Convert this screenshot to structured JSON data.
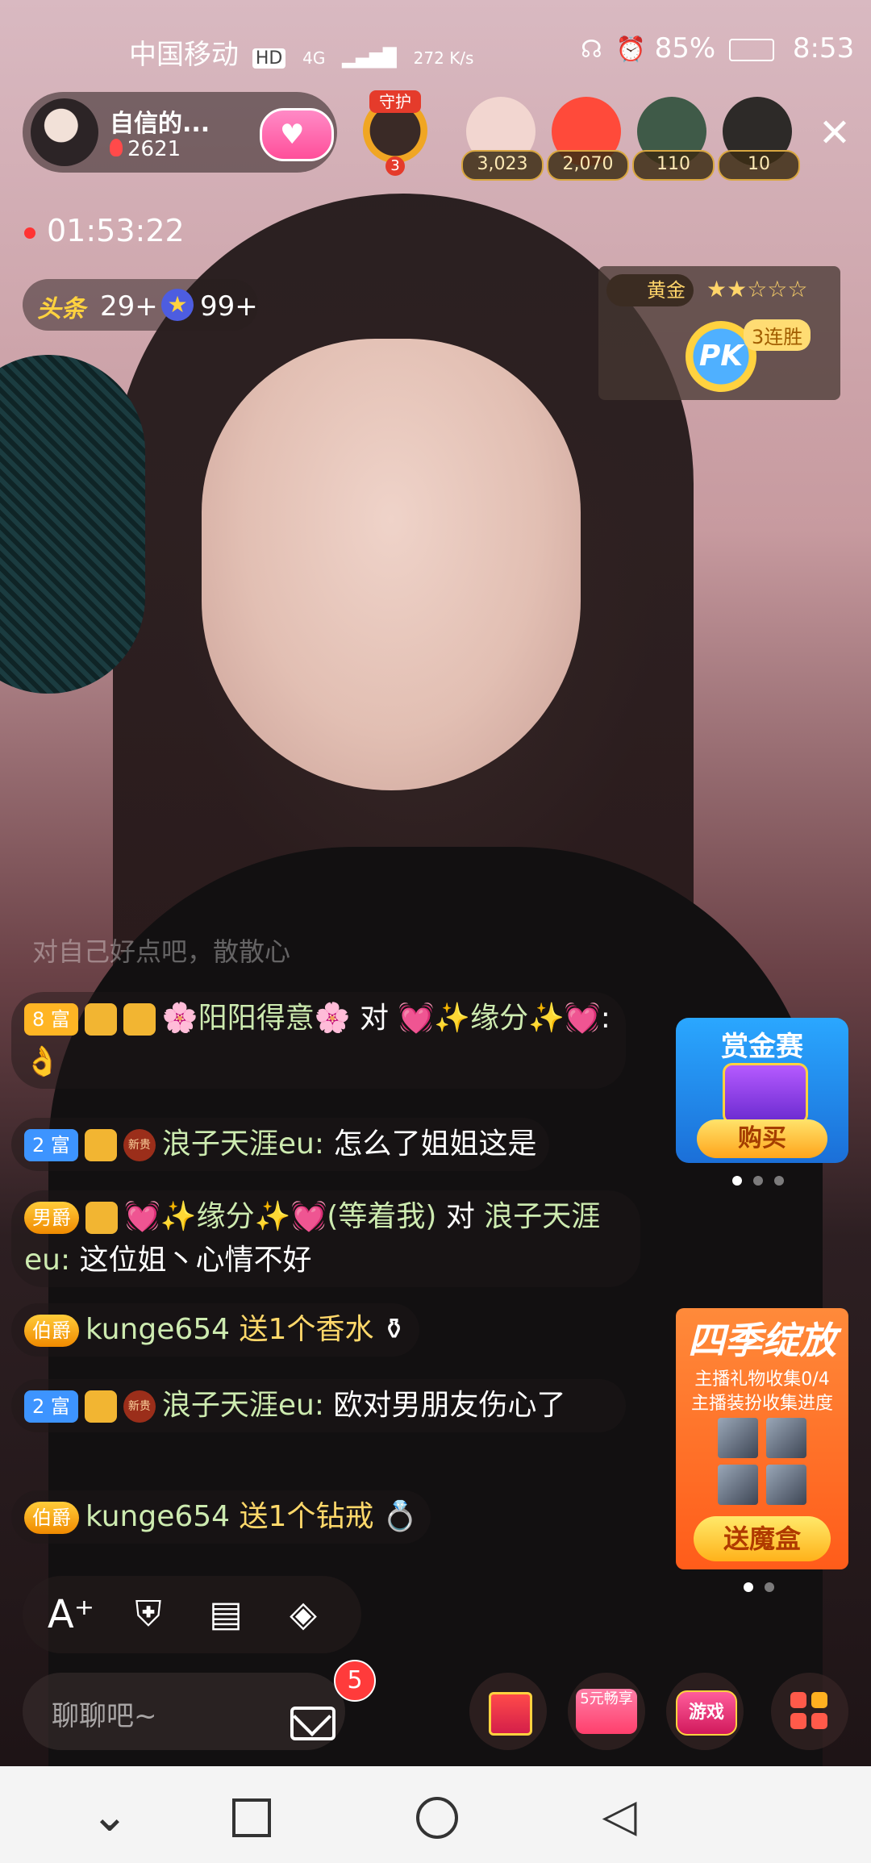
{
  "status_bar": {
    "carrier": "中国移动",
    "hd": "HD",
    "network": "4G",
    "speed": "272 K/s",
    "battery": "85%",
    "time": "8:53"
  },
  "host": {
    "name": "自信的...",
    "fans": "2621",
    "guard_level": "3",
    "guard_label": "守护"
  },
  "viewers": [
    {
      "count": "3,023",
      "color": "#f2d6d0"
    },
    {
      "count": "2,070",
      "color": "#ff4a3a"
    },
    {
      "count": "110",
      "color": "#3f5a48"
    },
    {
      "count": "10",
      "color": "#2d2a28"
    }
  ],
  "stream": {
    "timer": "01:53:22",
    "toutiao_label": "头条",
    "toutiao_count": "29+",
    "star_count": "99+"
  },
  "pk": {
    "tier": "黄金",
    "stars": "★★☆☆☆",
    "icon_label": "PK",
    "streak": "3连胜"
  },
  "chat": {
    "faded_line": "对自己好点吧，散散心",
    "messages": [
      {
        "badge": "8 富",
        "text_parts": [
          "🌸阳阳得意🌸",
          " 对 ",
          "💓✨缘分✨💓",
          ": 👌"
        ]
      },
      {
        "badge": "2 富",
        "user": "浪子天涯eu:",
        "text": " 怎么了姐姐这是"
      },
      {
        "badge": "男爵",
        "user": "💓✨缘分✨💓(等着我)",
        "text_parts": [
          " 对 ",
          "浪子天涯eu:",
          " 这位姐丶心情不好"
        ]
      },
      {
        "badge": "伯爵",
        "user": "kunge654",
        "gift": " 送1个香水"
      },
      {
        "badge": "2 富",
        "user": "浪子天涯eu:",
        "text": " 欧对男朋友伤心了"
      },
      {
        "badge": "伯爵",
        "user": "kunge654",
        "gift": " 送1个钻戒"
      }
    ],
    "xingui": "新贵"
  },
  "widgets": {
    "bounty_title": "赏金赛",
    "bounty_button": "购买",
    "season_title": "四季绽放",
    "season_line1": "主播礼物收集0/4",
    "season_line2": "主播装扮收集进度",
    "season_button": "送魔盒"
  },
  "bottom": {
    "chat_placeholder": "聊聊吧~",
    "mail_count": "5",
    "yuan_label": "5元畅享",
    "game_label": "游戏"
  }
}
